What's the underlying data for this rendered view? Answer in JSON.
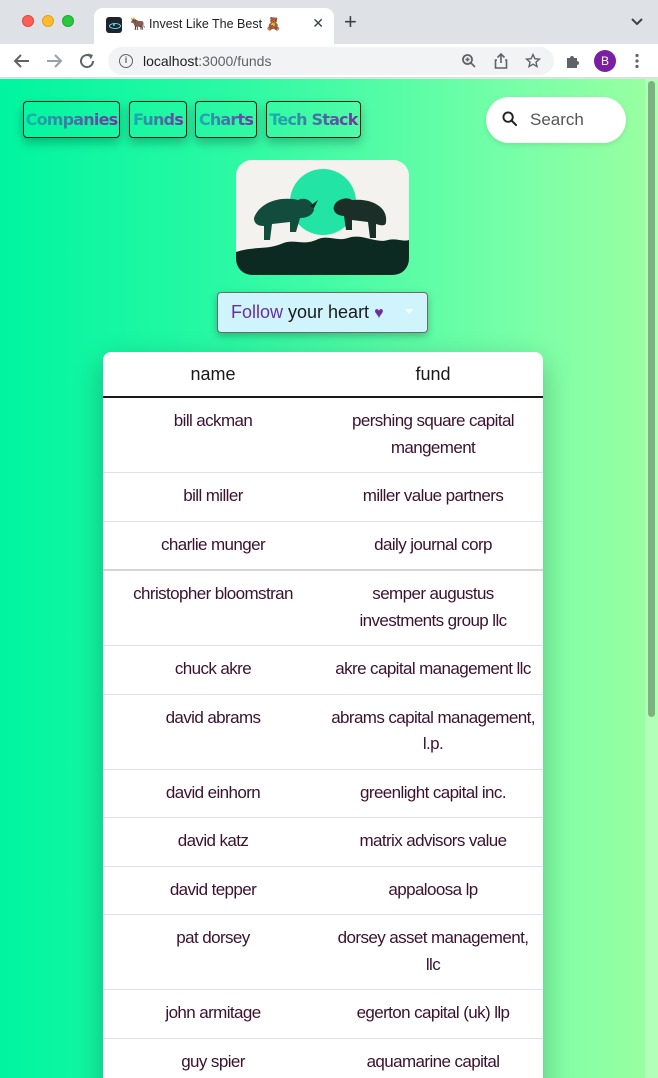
{
  "browser": {
    "tab_title": "🐂 Invest Like The Best 🧸",
    "url_host": "localhost",
    "url_path": ":3000/funds",
    "profile_initial": "B"
  },
  "nav": {
    "companies": "Companies",
    "funds": "Funds",
    "charts": "Charts",
    "tech_stack": "Tech Stack"
  },
  "search": {
    "placeholder": "Search"
  },
  "hero": {
    "image": "bull-vs-bear-illustration"
  },
  "dropdown": {
    "follow": "Follow",
    "your_heart": " your heart ",
    "heart": "♥"
  },
  "table": {
    "headers": [
      "name",
      "fund"
    ],
    "rows": [
      {
        "name": "bill ackman",
        "fund": "pershing square capital mangement"
      },
      {
        "name": "bill miller",
        "fund": "miller value partners"
      },
      {
        "name": "charlie munger",
        "fund": "daily journal corp"
      },
      {
        "name": "christopher bloomstran",
        "fund": "semper augustus investments group llc"
      },
      {
        "name": "chuck akre",
        "fund": "akre capital management llc"
      },
      {
        "name": "david abrams",
        "fund": "abrams capital management, l.p."
      },
      {
        "name": "david einhorn",
        "fund": "greenlight capital inc."
      },
      {
        "name": "david katz",
        "fund": "matrix advisors value"
      },
      {
        "name": "david tepper",
        "fund": "appaloosa lp"
      },
      {
        "name": "pat dorsey",
        "fund": "dorsey asset management, llc"
      },
      {
        "name": "john armitage",
        "fund": "egerton capital (uk) llp"
      },
      {
        "name": "guy spier",
        "fund": "aquamarine capital management, llc"
      }
    ]
  }
}
